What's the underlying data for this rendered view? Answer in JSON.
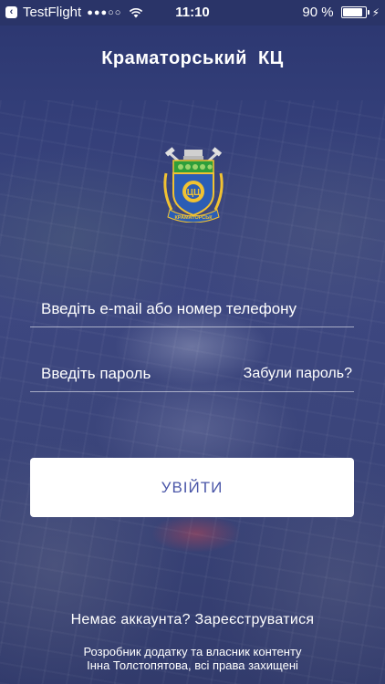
{
  "status_bar": {
    "back_app": "TestFlight",
    "signal": "●●●○○",
    "time": "11:10",
    "battery": "90 %"
  },
  "header": {
    "title": "Краматорський  КЦ"
  },
  "emblem": {
    "ribbon_text": "КРАМАТОРСЬК",
    "shield_text": "ЦЦ"
  },
  "form": {
    "email_placeholder": "Введіть e-mail або номер телефону",
    "password_placeholder": "Введіть пароль",
    "forgot_label": "Забули пароль?",
    "login_label": "УВІЙТИ"
  },
  "register_text": "Немає аккаунта? Зареєструватися",
  "footer": {
    "line1": "Розробник додатку та власник контенту",
    "line2": "Інна Толстопятова, всі права захищені"
  },
  "colors": {
    "accent": "#4a56a8",
    "background": "#2c3566"
  }
}
